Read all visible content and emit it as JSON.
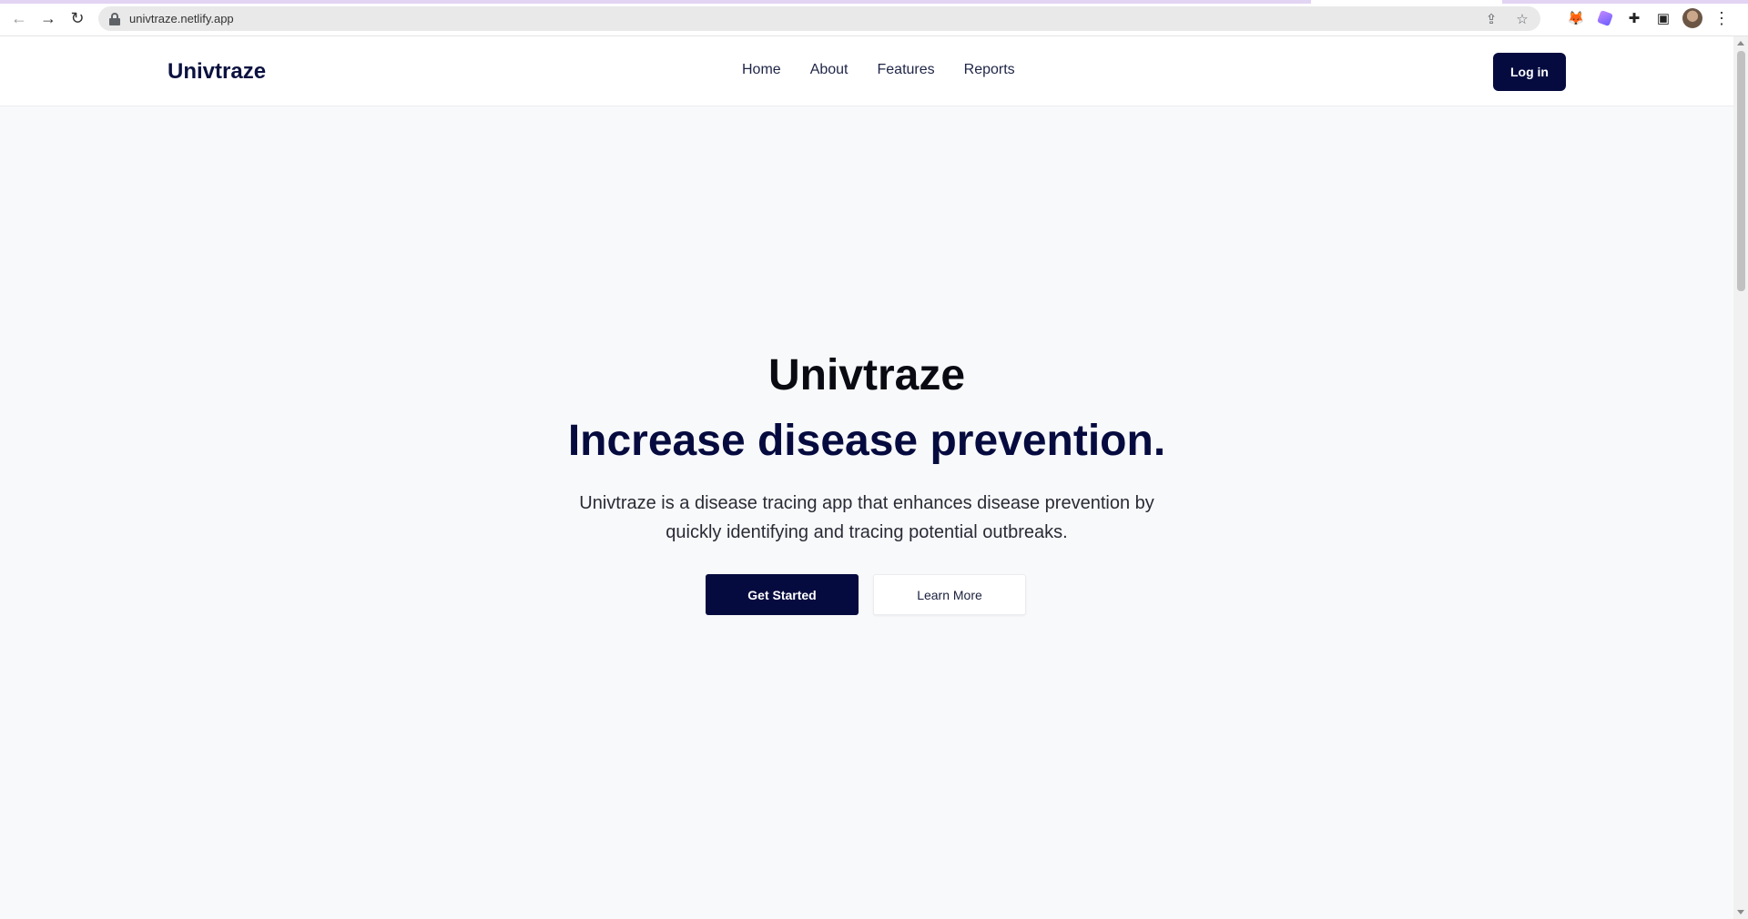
{
  "browser": {
    "url": "univtraze.netlify.app",
    "icons": [
      "back-icon",
      "forward-icon",
      "reload-icon",
      "lock-icon",
      "share-icon",
      "bookmark-star-icon",
      "metamask-fox-icon",
      "extension-gem-icon",
      "puzzle-extensions-icon",
      "side-panel-icon",
      "profile-avatar",
      "more-menu-icon"
    ],
    "glyphs": {
      "back": "←",
      "forward": "→",
      "reload": "↻",
      "share": "⇪",
      "star": "☆",
      "fox": "🦊",
      "puzzle": "✚",
      "panel": "▣",
      "kebab": "⋮"
    }
  },
  "header": {
    "brand": "Univtraze",
    "nav": [
      "Home",
      "About",
      "Features",
      "Reports"
    ],
    "login_label": "Log in"
  },
  "hero": {
    "title": "Univtraze",
    "subtitle": "Increase disease prevention.",
    "description": "Univtraze is a disease tracing app that enhances disease prevention by quickly identifying and tracing potential outbreaks.",
    "primary_cta": "Get Started",
    "secondary_cta": "Learn More"
  },
  "colors": {
    "brand_navy": "#060b3f",
    "page_background": "#f8f9fb"
  }
}
